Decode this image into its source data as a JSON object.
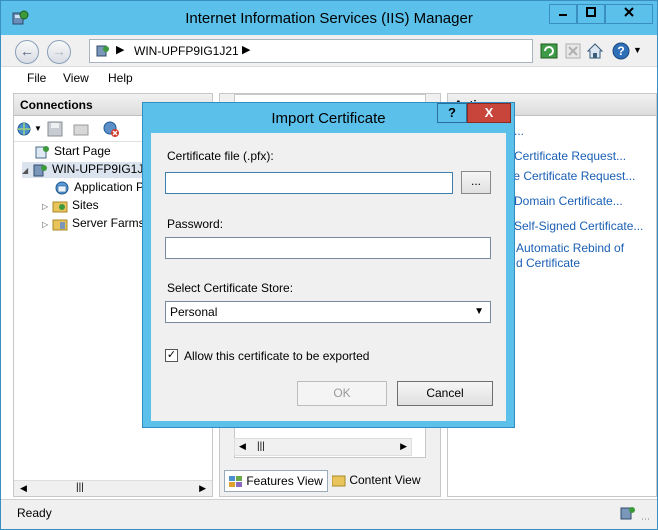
{
  "window": {
    "title": "Internet Information Services (IIS) Manager"
  },
  "nav": {
    "address_text": "WIN-UPFP9IG1J21"
  },
  "menu": {
    "items": [
      "File",
      "View",
      "Help"
    ]
  },
  "connections": {
    "header": "Connections",
    "tree": [
      {
        "label": "Start Page"
      },
      {
        "label": "WIN-UPFP9IG1J2"
      },
      {
        "label": "Application P"
      },
      {
        "label": "Sites"
      },
      {
        "label": "Server Farms"
      }
    ]
  },
  "middle": {
    "tabs": [
      {
        "label": "Features View"
      },
      {
        "label": "Content View"
      }
    ]
  },
  "actions": {
    "header": "Actio",
    "links": [
      "...",
      "Certificate Request...",
      "te Certificate Request...",
      "Domain Certificate...",
      "Self-Signed Certificate...",
      "Automatic Rebind of",
      "d Certificate"
    ]
  },
  "status": {
    "text": "Ready"
  },
  "dialog": {
    "title": "Import Certificate",
    "help_label": "?",
    "close_label": "X",
    "cert_file_label": "Certificate file (.pfx):",
    "cert_file_value": "",
    "browse_label": "...",
    "password_label": "Password:",
    "password_value": "",
    "store_label": "Select Certificate Store:",
    "store_value": "Personal",
    "export_label": "Allow this certificate to be exported",
    "export_checked": true,
    "ok_label": "OK",
    "cancel_label": "Cancel"
  }
}
